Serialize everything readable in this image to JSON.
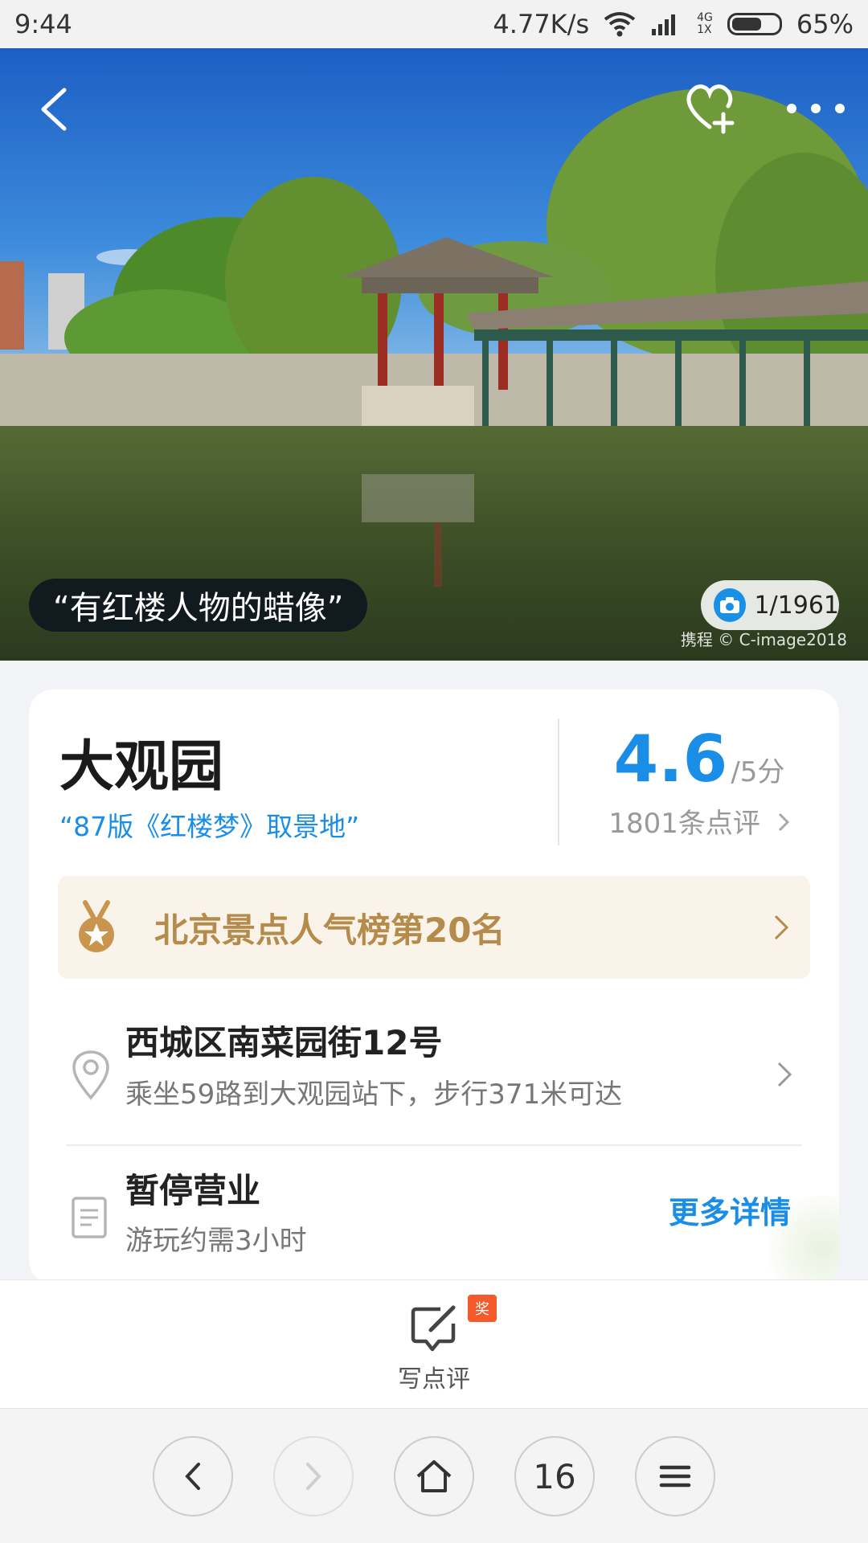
{
  "status_bar": {
    "time": "9:44",
    "net_speed": "4.77K/s",
    "network_top": "4G",
    "network_bottom": "1X",
    "battery": "65%"
  },
  "hero": {
    "quote": "“有红楼人物的蜡像”",
    "photo_count": "1/1961",
    "credit": "携程 © C-image2018",
    "icons": {
      "back": "back-arrow-icon",
      "favorite": "heart-plus-icon",
      "more": "more-dots-icon",
      "camera": "camera-icon"
    }
  },
  "attraction": {
    "name": "大观园",
    "tagline": "“87版《红楼梦》取景地”",
    "rating": "4.6",
    "rating_unit": "/5分",
    "review_count": "1801条点评",
    "rank": "北京景点人气榜第20名",
    "address": "西城区南菜园街12号",
    "transit": "乘坐59路到大观园站下，步行371米可达",
    "status": "暂停营业",
    "duration": "游玩约需3小时",
    "more_details": "更多详情"
  },
  "write_review": {
    "label": "写点评",
    "badge": "奖"
  },
  "browser_nav": {
    "tabs_count": "16"
  },
  "colors": {
    "accent": "#1a8de6",
    "rank_text": "#b58b4c",
    "rank_bg": "#faf3e9",
    "badge": "#f55a2c"
  }
}
